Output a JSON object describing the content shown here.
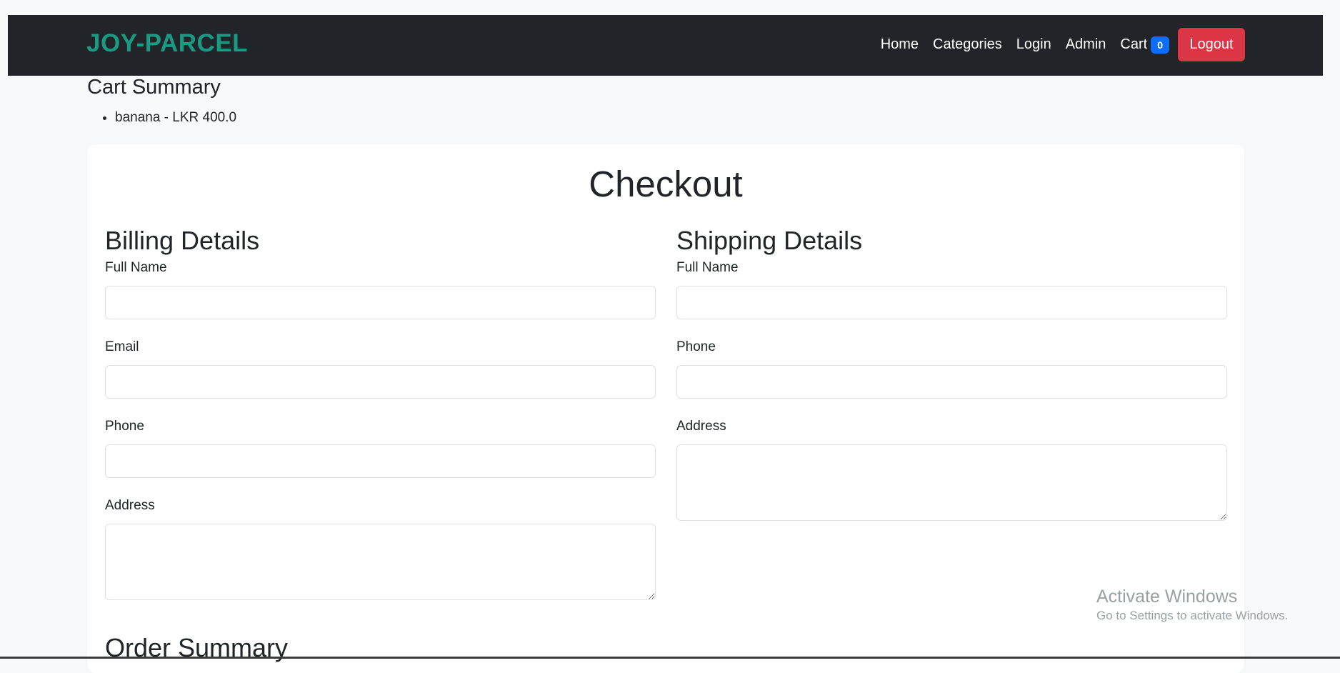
{
  "navbar": {
    "brand": "JOY-PARCEL",
    "links": [
      "Home",
      "Categories",
      "Login",
      "Admin"
    ],
    "cart_label": "Cart",
    "cart_count": "0",
    "logout_label": "Logout"
  },
  "cart_summary": {
    "title": "Cart Summary",
    "items": [
      "banana - LKR 400.0"
    ]
  },
  "checkout": {
    "title": "Checkout",
    "billing": {
      "title": "Billing Details",
      "full_name_label": "Full Name",
      "email_label": "Email",
      "phone_label": "Phone",
      "address_label": "Address"
    },
    "shipping": {
      "title": "Shipping Details",
      "full_name_label": "Full Name",
      "phone_label": "Phone",
      "address_label": "Address"
    },
    "order_summary_title": "Order Summary"
  },
  "watermark": {
    "title": "Activate Windows",
    "subtitle": "Go to Settings to activate Windows."
  },
  "colors": {
    "brand": "#1a9a82",
    "navbar_bg": "#212529",
    "logout": "#dc3545",
    "badge": "#0d6efd"
  }
}
